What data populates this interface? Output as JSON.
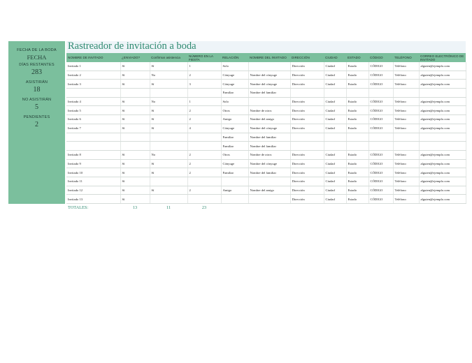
{
  "title": "Rastreador de invitación a boda",
  "sidebar": {
    "date_label": "FECHA DE LA BODA",
    "date_value": "FECHA",
    "days_label": "DÍAS RESTANTES",
    "days_value": "283",
    "attending_label": "ASISTIRÁN",
    "attending_value": "18",
    "not_attending_label": "NO ASISTIRÁN",
    "not_attending_value": "5",
    "pending_label": "PENDIENTES",
    "pending_value": "2"
  },
  "columns": [
    "NOMBRE DE INVITADO",
    "¿ENVIADO?",
    "Confirmar asistencia",
    "NÚMERO EN LA FIESTA",
    "RELACIÓN",
    "NOMBRE DEL INVITADO",
    "DIRECCIÓN",
    "CIUDAD",
    "ESTADO",
    "CÓDIGO",
    "TELÉFONO",
    "CORREO ELECTRÓNICO DE INVITADO"
  ],
  "rows": [
    [
      "Invitado 1",
      "Sí",
      "Sí",
      "1",
      "Solo",
      "",
      "Dirección",
      "Ciudad",
      "Estado",
      "CÓDIGO",
      "Teléfono",
      "alguien@ejemplo.com"
    ],
    [
      "Invitado 2",
      "Sí",
      "No",
      "2",
      "Cónyuge",
      "Nombre del cónyuge",
      "Dirección",
      "Ciudad",
      "Estado",
      "CÓDIGO",
      "Teléfono",
      "alguien@ejemplo.com"
    ],
    [
      "Invitado 3",
      "Sí",
      "Sí",
      "3",
      "Cónyuge",
      "Nombre del cónyuge",
      "Dirección",
      "Ciudad",
      "Estado",
      "CÓDIGO",
      "Teléfono",
      "alguien@ejemplo.com"
    ],
    [
      "",
      "",
      "",
      "",
      "Familiar",
      "Nombre del familiar",
      "",
      "",
      "",
      "",
      "",
      ""
    ],
    [
      "Invitado 4",
      "Sí",
      "No",
      "1",
      "Solo",
      "",
      "Dirección",
      "Ciudad",
      "Estado",
      "CÓDIGO",
      "Teléfono",
      "alguien@ejemplo.com"
    ],
    [
      "Invitado 5",
      "Sí",
      "Sí",
      "2",
      "Otros",
      "Nombre de otros",
      "Dirección",
      "Ciudad",
      "Estado",
      "CÓDIGO",
      "Teléfono",
      "alguien@ejemplo.com"
    ],
    [
      "Invitado 6",
      "Sí",
      "Sí",
      "2",
      "Amigo",
      "Nombre del amigo",
      "Dirección",
      "Ciudad",
      "Estado",
      "CÓDIGO",
      "Teléfono",
      "alguien@ejemplo.com"
    ],
    [
      "Invitado 7",
      "Sí",
      "Sí",
      "4",
      "Cónyuge",
      "Nombre del cónyuge",
      "Dirección",
      "Ciudad",
      "Estado",
      "CÓDIGO",
      "Teléfono",
      "alguien@ejemplo.com"
    ],
    [
      "",
      "",
      "",
      "",
      "Familiar",
      "Nombre del familiar",
      "",
      "",
      "",
      "",
      "",
      ""
    ],
    [
      "",
      "",
      "",
      "",
      "Familiar",
      "Nombre del familiar",
      "",
      "",
      "",
      "",
      "",
      ""
    ],
    [
      "Invitado 8",
      "Sí",
      "No",
      "2",
      "Otros",
      "Nombre de otros",
      "Dirección",
      "Ciudad",
      "Estado",
      "CÓDIGO",
      "Teléfono",
      "alguien@ejemplo.com"
    ],
    [
      "Invitado 9",
      "Sí",
      "Sí",
      "2",
      "Cónyuge",
      "Nombre del cónyuge",
      "Dirección",
      "Ciudad",
      "Estado",
      "CÓDIGO",
      "Teléfono",
      "alguien@ejemplo.com"
    ],
    [
      "Invitado 10",
      "Sí",
      "Sí",
      "2",
      "Familiar",
      "Nombre del familiar",
      "Dirección",
      "Ciudad",
      "Estado",
      "CÓDIGO",
      "Teléfono",
      "alguien@ejemplo.com"
    ],
    [
      "Invitado 11",
      "Sí",
      "",
      "",
      "",
      "",
      "Dirección",
      "Ciudad",
      "Estado",
      "CÓDIGO",
      "Teléfono",
      "alguien@ejemplo.com"
    ],
    [
      "Invitado 12",
      "Sí",
      "Sí",
      "2",
      "Amigo",
      "Nombre del amigo",
      "Dirección",
      "Ciudad",
      "Estado",
      "CÓDIGO",
      "Teléfono",
      "alguien@ejemplo.com"
    ],
    [
      "Invitado 13",
      "Sí",
      "",
      "",
      "",
      "",
      "Dirección",
      "Ciudad",
      "Estado",
      "CÓDIGO",
      "Teléfono",
      "alguien@ejemplo.com"
    ]
  ],
  "totals": [
    "TOTALES:",
    "13",
    "11",
    "23",
    "",
    "",
    "",
    "",
    "",
    "",
    "",
    ""
  ]
}
